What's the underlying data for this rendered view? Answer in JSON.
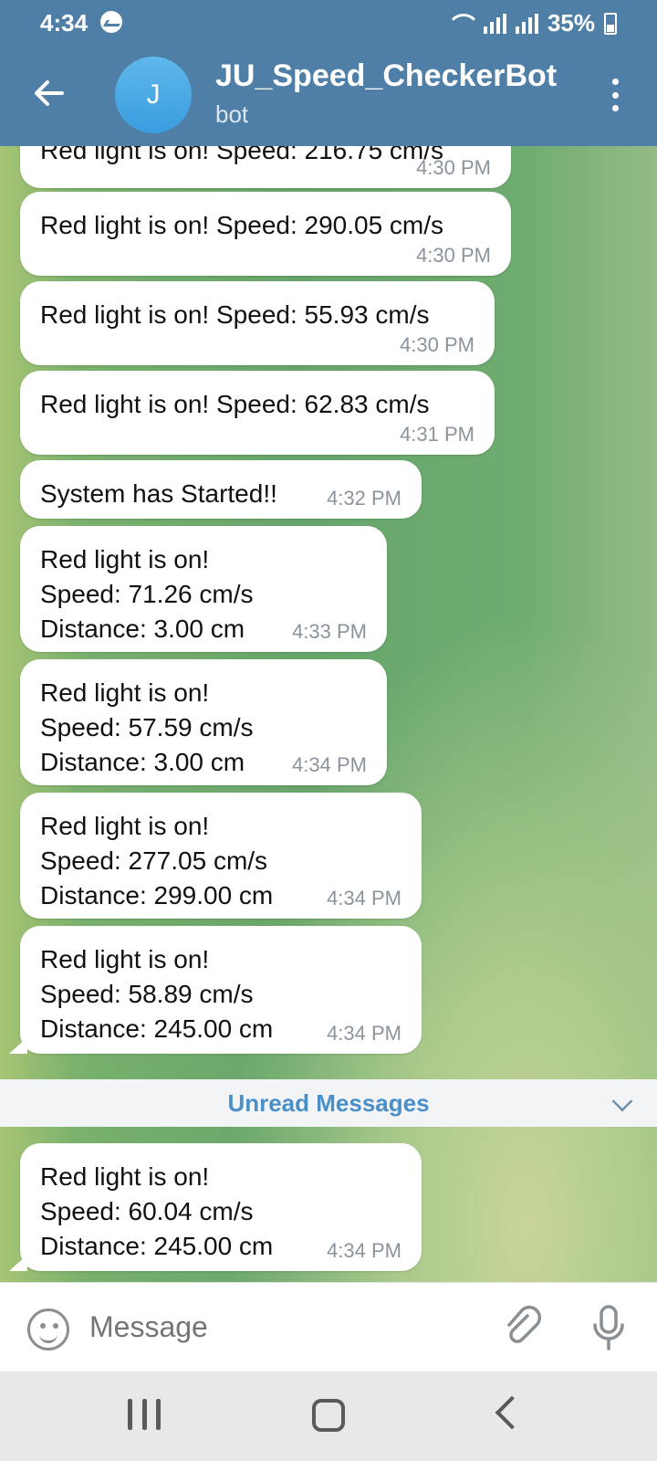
{
  "status_bar": {
    "time": "4:34",
    "battery": "35%"
  },
  "header": {
    "title": "JU_Speed_CheckerBot",
    "subtitle": "bot",
    "avatar_letter": "J"
  },
  "messages": [
    {
      "text": "Red light is on! Speed: 216.75 cm/s",
      "time": "4:30 PM"
    },
    {
      "text": "Red light is on! Speed: 290.05 cm/s",
      "time": "4:30 PM"
    },
    {
      "text": "Red light is on! Speed: 55.93 cm/s",
      "time": "4:30 PM"
    },
    {
      "text": "Red light is on! Speed: 62.83 cm/s",
      "time": "4:31 PM"
    },
    {
      "text": "System has Started!!",
      "time": "4:32 PM"
    },
    {
      "text": "Red light is on!\nSpeed: 71.26 cm/s\nDistance: 3.00 cm",
      "time": "4:33 PM"
    },
    {
      "text": "Red light is on!\nSpeed: 57.59 cm/s\nDistance: 3.00 cm",
      "time": "4:34 PM"
    },
    {
      "text": "Red light is on!\nSpeed: 277.05 cm/s\nDistance: 299.00 cm",
      "time": "4:34 PM"
    },
    {
      "text": "Red light is on!\nSpeed: 58.89 cm/s\nDistance: 245.00 cm",
      "time": "4:34 PM"
    },
    {
      "text": "Red light is on!\nSpeed: 60.04 cm/s\nDistance: 245.00 cm",
      "time": "4:34 PM"
    }
  ],
  "unread_label": "Unread Messages",
  "input": {
    "placeholder": "Message"
  }
}
